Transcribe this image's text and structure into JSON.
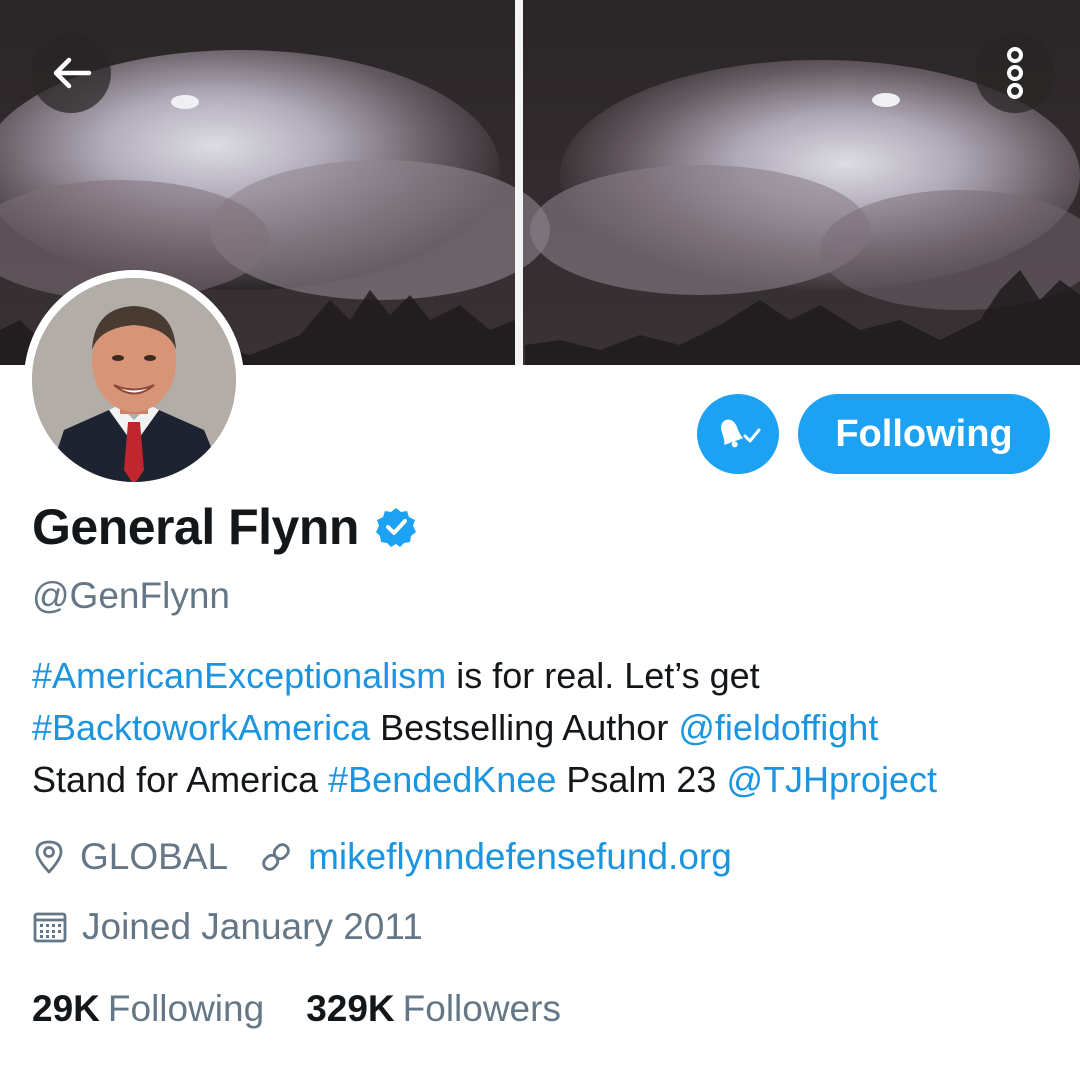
{
  "header": {
    "back_icon": "arrow-left-icon",
    "more_icon": "more-vertical-icon",
    "banner_description_colors": {
      "sky": "#2a2526",
      "cloud": "#cfc9d4"
    }
  },
  "profile": {
    "name": "General Flynn",
    "verified": true,
    "handle": "@GenFlynn",
    "notify_icon": "bell-check-icon",
    "follow_button_label": "Following",
    "bio": {
      "line1": {
        "hashtag": "#AmericanExceptionalism",
        "text": " is for real. Let’s get"
      },
      "line2": {
        "hashtag": "#BacktoworkAmerica",
        "text": " Bestselling Author ",
        "mention": "@fieldoffight"
      },
      "line3": {
        "text1": "Stand for America ",
        "hashtag": "#BendedKnee",
        "text2": " Psalm 23 ",
        "mention": "@TJHproject"
      }
    },
    "location": "GLOBAL",
    "website": "mikeflynndefensefund.org",
    "joined": "Joined January 2011",
    "stats": {
      "following_count": "29K",
      "following_label": "Following",
      "followers_count": "329K",
      "followers_label": "Followers"
    }
  },
  "colors": {
    "accent": "#1da1f2",
    "link": "#1b95e0",
    "secondary_text": "#657786",
    "primary_text": "#14171a"
  }
}
